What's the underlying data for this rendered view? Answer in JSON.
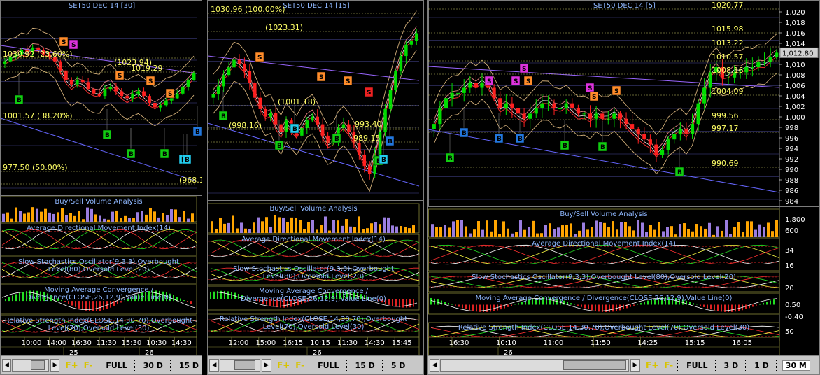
{
  "panels": [
    {
      "title": "SET50 DEC 14   [30]",
      "price_labels": [
        "1030.92 (23.60%)",
        "1001.57 (38.20%)",
        "977.50 (50.00%)",
        "(1023.94)",
        "1019.29",
        "(968.1"
      ],
      "sub_titles": [
        "Buy/Sell Volume Analysis",
        "Average Directional Movement Index(14)",
        "Slow Stochastics Oscillator(9,3,3),Overbought",
        "Level(80),Oversold Level(20)",
        "Moving Average Convergence /",
        "Divergence(CLOSE,26,12,9),Value Line(0)",
        "Relative Strength Index(CLOSE,14,30,70),Overbought",
        "Level(70),Oversold Level(30)"
      ],
      "time_labels": [
        "10:00",
        "14:00",
        "16:30",
        "11:30",
        "15:30",
        "10:30",
        "14:30"
      ],
      "date_labels": [
        "25",
        "26"
      ],
      "buttons": [
        "FULL",
        "30 D",
        "15 D"
      ]
    },
    {
      "title": "SET50 DEC 14   [15]",
      "price_labels": [
        "1030.96 (100.00%)",
        "(1023.31)",
        "(1001.18)",
        "(998.16)",
        "993.40",
        "989.15"
      ],
      "sub_titles": [
        "Buy/Sell Volume Analysis",
        "Average Directional Movement Index(14)",
        "Slow Stochastics Oscillator(9,3,3),Overbought",
        "Level(80),Oversold Level(20)",
        "Moving Average Convergence /",
        "Divergence(CLOSE,26,12,9),Value Line(0)",
        "Relative Strength Index(CLOSE,14,30,70),Overbought",
        "Level(70),Oversold Level(30)"
      ],
      "time_labels": [
        "12:00",
        "15:00",
        "16:15",
        "10:15",
        "11:30",
        "14:30",
        "15:45"
      ],
      "date_labels": [
        "26"
      ],
      "buttons": [
        "FULL",
        "15 D",
        "5 D"
      ]
    },
    {
      "title": "SET50 DEC 14   [5]",
      "price_labels": [
        "1020.77",
        "1015.98",
        "1013.22",
        "1010.57",
        "1008.16",
        "1004.09",
        "999.56",
        "997.17",
        "990.69"
      ],
      "current_price": "1,012.80",
      "axis_ticks": [
        "1,020",
        "1,018",
        "1,016",
        "1,014",
        "1,012",
        "1,010",
        "1,008",
        "1,006",
        "1,004",
        "1,002",
        "1,000",
        "998",
        "996",
        "994",
        "992",
        "990",
        "988",
        "986",
        "984"
      ],
      "volume_ticks": [
        "1,800",
        "600"
      ],
      "adx_ticks": [
        "34",
        "16"
      ],
      "stoch_ticks": [
        "20"
      ],
      "macd_ticks": [
        "0.50",
        "-0.40"
      ],
      "rsi_ticks": [
        "50"
      ],
      "sub_titles": [
        "Buy/Sell Volume Analysis",
        "Average Directional Movement Index(14)",
        "Slow Stochastics Oscillator(9,3,3),Overbought Level(80),Oversold Level(20)",
        "Moving Average Convergence / Divergence(CLOSE,26,12,9),Value Line(0)",
        "Relative Strength Index(CLOSE,14,30,70),Overbought Level(70),Oversold Level(30)"
      ],
      "time_labels": [
        "16:30",
        "10:10",
        "11:00",
        "11:50",
        "14:25",
        "15:15",
        "16:05"
      ],
      "date_labels": [
        "26"
      ],
      "buttons": [
        "FULL",
        "3 D",
        "1 D",
        "30 M"
      ]
    }
  ],
  "fplus_label": "F+",
  "fminus_label": "F-",
  "colors": {
    "bull": "#00dd00",
    "bear": "#ff2020",
    "volume": "#ffa500",
    "volume_alt": "#9b7ee0",
    "label": "#ffff66",
    "title": "#8fb8ff"
  },
  "chart_data": [
    {
      "type": "candlestick",
      "title": "SET50 DEC 14   [30]",
      "close": [
        1018,
        1020,
        1021,
        1023,
        1022,
        1024,
        1023,
        1021,
        1020,
        1018,
        1014,
        1010,
        1008,
        1010,
        1009,
        1006,
        1004,
        1003,
        1006,
        1007,
        1005,
        1003,
        1002,
        1004,
        1005,
        1003,
        1000,
        998,
        999,
        1001,
        1002,
        1004,
        1007,
        1010,
        1013
      ],
      "ylim": [
        960,
        1040
      ],
      "buy_signals": 8,
      "sell_signals": 5
    },
    {
      "type": "candlestick",
      "title": "SET50 DEC 14   [15]",
      "close": [
        1012,
        1014,
        1017,
        1019,
        1021,
        1020,
        1018,
        1015,
        1011,
        1008,
        1006,
        1007,
        1004,
        1002,
        1005,
        1003,
        1001,
        1003,
        1005,
        1006,
        1004,
        1001,
        999,
        1000,
        1003,
        1004,
        1002,
        999,
        996,
        993,
        991,
        996,
        1002,
        1008,
        1013,
        1018,
        1022,
        1025,
        1026,
        1028
      ],
      "ylim": [
        984,
        1034
      ],
      "buy_signals": 7,
      "sell_signals": 4
    },
    {
      "type": "candlestick",
      "title": "SET50 DEC 14   [5]",
      "close": [
        999,
        1002,
        1004,
        1005,
        1005,
        1006,
        1007,
        1006,
        1007,
        1006,
        1004,
        1002,
        1003,
        1002,
        1001,
        1000,
        1001,
        1002,
        1003,
        1003,
        1002,
        1002,
        1003,
        1002,
        1001,
        1001,
        1000,
        1001,
        1000,
        1000,
        1001,
        1000,
        999,
        998,
        997,
        996,
        995,
        993,
        994,
        996,
        997,
        998,
        997,
        999,
        1003,
        1006,
        1009,
        1010,
        1008,
        1008,
        1009,
        1009,
        1010,
        1010,
        1011,
        1011,
        1012,
        1012.8
      ],
      "ylim": [
        983,
        1021
      ],
      "buy_signals": 7,
      "sell_signals": 8
    }
  ]
}
